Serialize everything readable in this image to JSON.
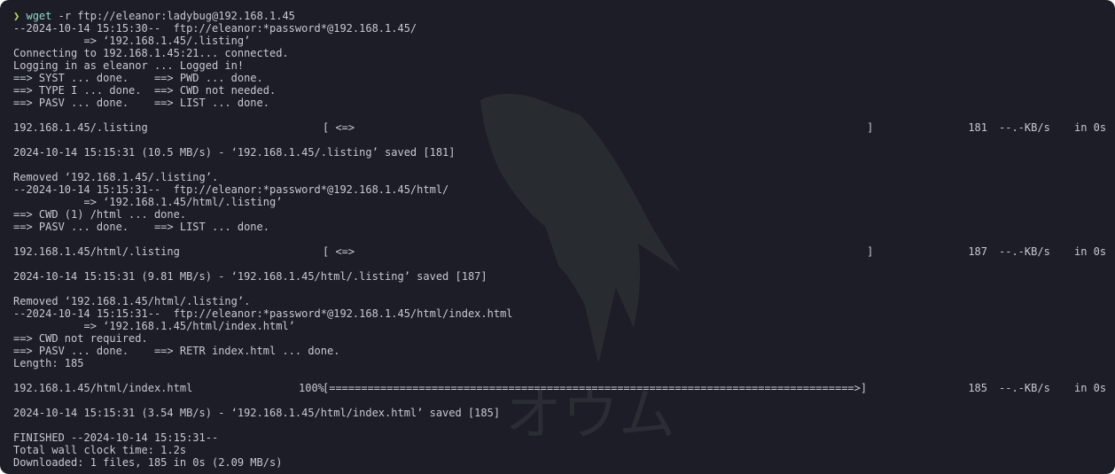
{
  "prompt": {
    "symbol": "❯",
    "command": "wget",
    "args": " -r ftp://eleanor:ladybug@192.168.1.45"
  },
  "lines": {
    "l2": "--2024-10-14 15:15:30--  ftp://eleanor:*password*@192.168.1.45/",
    "l3": "           => ‘192.168.1.45/.listing’",
    "l4": "Connecting to 192.168.1.45:21... connected.",
    "l5": "Logging in as eleanor ... Logged in!",
    "l6": "==> SYST ... done.    ==> PWD ... done.",
    "l7": "==> TYPE I ... done.  ==> CWD not needed.",
    "l8": "==> PASV ... done.    ==> LIST ... done.",
    "l11": "2024-10-14 15:15:31 (10.5 MB/s) - ‘192.168.1.45/.listing’ saved [181]",
    "l13": "Removed ‘192.168.1.45/.listing’.",
    "l14": "--2024-10-14 15:15:31--  ftp://eleanor:*password*@192.168.1.45/html/",
    "l15": "           => ‘192.168.1.45/html/.listing’",
    "l16": "==> CWD (1) /html ... done.",
    "l17": "==> PASV ... done.    ==> LIST ... done.",
    "l21": "2024-10-14 15:15:31 (9.81 MB/s) - ‘192.168.1.45/html/.listing’ saved [187]",
    "l23": "Removed ‘192.168.1.45/html/.listing’.",
    "l24": "--2024-10-14 15:15:31--  ftp://eleanor:*password*@192.168.1.45/html/index.html",
    "l25": "           => ‘192.168.1.45/html/index.html’",
    "l26": "==> CWD not required.",
    "l27": "==> PASV ... done.    ==> RETR index.html ... done.",
    "l28": "Length: 185",
    "l32": "2024-10-14 15:15:31 (3.54 MB/s) - ‘192.168.1.45/html/index.html’ saved [185]",
    "l34": "FINISHED --2024-10-14 15:15:31--",
    "l35": "Total wall clock time: 1.2s",
    "l36": "Downloaded: 1 files, 185 in 0s (2.09 MB/s)"
  },
  "progress": [
    {
      "name": "192.168.1.45/.listing",
      "pct": "",
      "bar": "[ <=>                                                                                ]",
      "size": "181",
      "rate": "--.-KB/s",
      "eta": "in 0s"
    },
    {
      "name": "192.168.1.45/html/.listing",
      "pct": "",
      "bar": "[ <=>                                                                                ]",
      "size": "187",
      "rate": "--.-KB/s",
      "eta": "in 0s"
    },
    {
      "name": "192.168.1.45/html/index.html",
      "pct": "100%",
      "bar": "[==================================================================================>]",
      "size": "185",
      "rate": "--.-KB/s",
      "eta": "in 0s"
    }
  ],
  "watermark_text": "オウム",
  "colors": {
    "background": "#1c1d26",
    "text": "#c6cad2",
    "prompt": "#b5e35a",
    "command": "#8fd9c9"
  }
}
